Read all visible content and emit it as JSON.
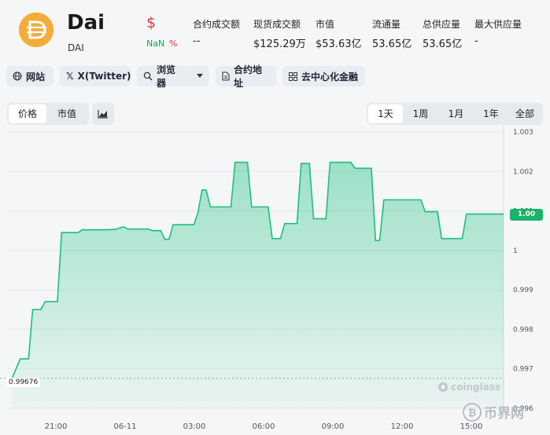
{
  "header": {
    "name": "Dai",
    "symbol": "DAI",
    "price": "$",
    "change_value": "NaN",
    "change_unit": "%",
    "colors": {
      "up": "#16a34a",
      "down": "#e0353b",
      "brand": "#f5ac37"
    }
  },
  "stats": [
    {
      "label": "合约成交额",
      "value": "--"
    },
    {
      "label": "现货成交额",
      "value": "$125.29万"
    },
    {
      "label": "市值",
      "value": "$53.63亿"
    },
    {
      "label": "流通量",
      "value": "53.65亿"
    },
    {
      "label": "总供应量",
      "value": "53.65亿"
    },
    {
      "label": "最大供应量",
      "value": "-"
    }
  ],
  "links": {
    "website": "网站",
    "twitter": "X(Twitter)",
    "explorer": "浏览器",
    "contract": "合约地址",
    "defi": "去中心化金融"
  },
  "chart_tabs": {
    "price": "价格",
    "marketcap": "市值"
  },
  "ranges": [
    "1天",
    "1周",
    "1月",
    "1年",
    "全部"
  ],
  "watermark": "coinglass",
  "corner_logo": "币界网",
  "chart_data": {
    "type": "area",
    "y_ticks": [
      "1.003",
      "1.002",
      "1.001",
      "1",
      "0.999",
      "0.998",
      "0.997",
      "0.996"
    ],
    "x_ticks": [
      "21:00",
      "06-11",
      "03:00",
      "06:00",
      "09:00",
      "12:00",
      "15:00"
    ],
    "ylim": [
      0.996,
      1.003
    ],
    "current_label": "1.00",
    "min_label": "0.99676",
    "series": [
      {
        "values": [
          [
            0.2,
            0.99676
          ],
          [
            0.6,
            0.99725
          ],
          [
            1.0,
            0.99725
          ],
          [
            1.2,
            0.9985
          ],
          [
            1.6,
            0.9985
          ],
          [
            1.8,
            0.9987
          ],
          [
            2.4,
            0.9987
          ],
          [
            2.6,
            1.00045
          ],
          [
            3.4,
            1.00045
          ],
          [
            3.6,
            1.00052
          ],
          [
            4.6,
            1.00052
          ],
          [
            5.2,
            1.00053
          ],
          [
            5.6,
            1.0006
          ],
          [
            5.8,
            1.00054
          ],
          [
            6.8,
            1.00054
          ],
          [
            7.0,
            1.0005
          ],
          [
            7.4,
            1.0005
          ],
          [
            7.6,
            1.00028
          ],
          [
            7.8,
            1.00028
          ],
          [
            8.0,
            1.00065
          ],
          [
            9.0,
            1.00065
          ],
          [
            9.2,
            1.00095
          ],
          [
            9.4,
            1.00153
          ],
          [
            9.6,
            1.00153
          ],
          [
            9.8,
            1.0011
          ],
          [
            10.8,
            1.0011
          ],
          [
            11.0,
            1.00223
          ],
          [
            11.6,
            1.00223
          ],
          [
            11.8,
            1.0011
          ],
          [
            12.6,
            1.0011
          ],
          [
            12.8,
            1.0003
          ],
          [
            13.2,
            1.0003
          ],
          [
            13.4,
            1.00068
          ],
          [
            14.0,
            1.00068
          ],
          [
            14.2,
            1.0022
          ],
          [
            14.6,
            1.0022
          ],
          [
            14.8,
            1.0008
          ],
          [
            15.4,
            1.0008
          ],
          [
            15.6,
            1.00223
          ],
          [
            16.6,
            1.00223
          ],
          [
            16.8,
            1.00208
          ],
          [
            17.6,
            1.00208
          ],
          [
            17.8,
            1.00025
          ],
          [
            18.0,
            1.00025
          ],
          [
            18.2,
            1.00128
          ],
          [
            20.0,
            1.00128
          ],
          [
            20.2,
            1.00098
          ],
          [
            20.8,
            1.00098
          ],
          [
            21.0,
            1.0003
          ],
          [
            22.0,
            1.0003
          ],
          [
            22.2,
            1.00092
          ],
          [
            24.0,
            1.00092
          ]
        ]
      }
    ]
  }
}
